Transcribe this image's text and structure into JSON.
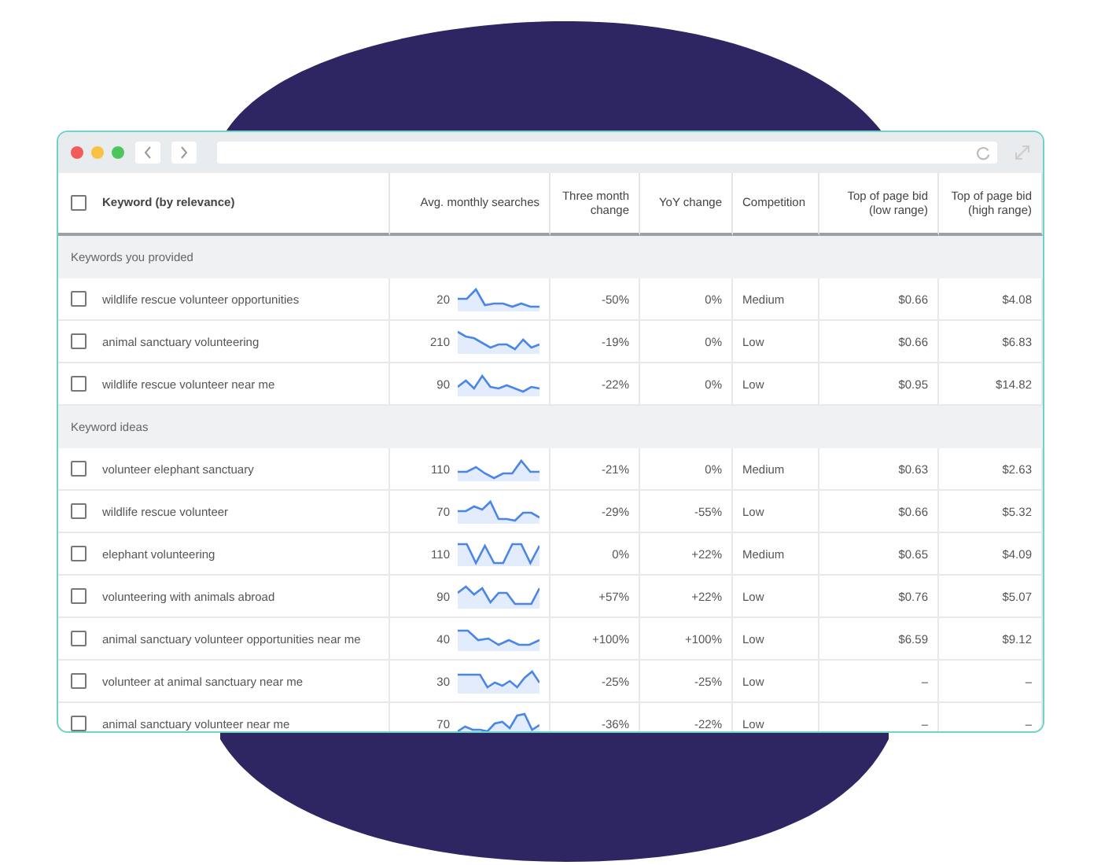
{
  "header": {
    "checked": false,
    "columns": [
      "Keyword (by relevance)",
      "Avg. monthly searches",
      "Three month change",
      "YoY change",
      "Competition",
      "Top of page bid (low range)",
      "Top of page bid (high range)"
    ]
  },
  "sections": [
    {
      "title": "Keywords you provided",
      "rows": [
        {
          "checked": false,
          "keyword": "wildlife rescue volunteer opportunities",
          "searches": "20",
          "three_month": "-50%",
          "yoy": "0%",
          "competition": "Medium",
          "bid_low": "$0.66",
          "bid_high": "$4.08"
        },
        {
          "checked": false,
          "keyword": "animal sanctuary volunteering",
          "searches": "210",
          "three_month": "-19%",
          "yoy": "0%",
          "competition": "Low",
          "bid_low": "$0.66",
          "bid_high": "$6.83"
        },
        {
          "checked": false,
          "keyword": "wildlife rescue volunteer near me",
          "searches": "90",
          "three_month": "-22%",
          "yoy": "0%",
          "competition": "Low",
          "bid_low": "$0.95",
          "bid_high": "$14.82"
        }
      ]
    },
    {
      "title": "Keyword ideas",
      "rows": [
        {
          "checked": false,
          "keyword": "volunteer elephant sanctuary",
          "searches": "110",
          "three_month": "-21%",
          "yoy": "0%",
          "competition": "Medium",
          "bid_low": "$0.63",
          "bid_high": "$2.63"
        },
        {
          "checked": false,
          "keyword": "wildlife rescue volunteer",
          "searches": "70",
          "three_month": "-29%",
          "yoy": "-55%",
          "competition": "Low",
          "bid_low": "$0.66",
          "bid_high": "$5.32"
        },
        {
          "checked": false,
          "keyword": "elephant volunteering",
          "searches": "110",
          "three_month": "0%",
          "yoy": "+22%",
          "competition": "Medium",
          "bid_low": "$0.65",
          "bid_high": "$4.09"
        },
        {
          "checked": false,
          "keyword": "volunteering with animals abroad",
          "searches": "90",
          "three_month": "+57%",
          "yoy": "+22%",
          "competition": "Low",
          "bid_low": "$0.76",
          "bid_high": "$5.07"
        },
        {
          "checked": false,
          "keyword": "animal sanctuary volunteer opportunities near me",
          "searches": "40",
          "three_month": "+100%",
          "yoy": "+100%",
          "competition": "Low",
          "bid_low": "$6.59",
          "bid_high": "$9.12"
        },
        {
          "checked": false,
          "keyword": "volunteer at animal sanctuary near me",
          "searches": "30",
          "three_month": "-25%",
          "yoy": "-25%",
          "competition": "Low",
          "bid_low": "–",
          "bid_high": "–"
        },
        {
          "checked": false,
          "keyword": "animal sanctuary volunteer near me",
          "searches": "70",
          "three_month": "-36%",
          "yoy": "-22%",
          "competition": "Low",
          "bid_low": "–",
          "bid_high": "–"
        }
      ]
    }
  ]
}
